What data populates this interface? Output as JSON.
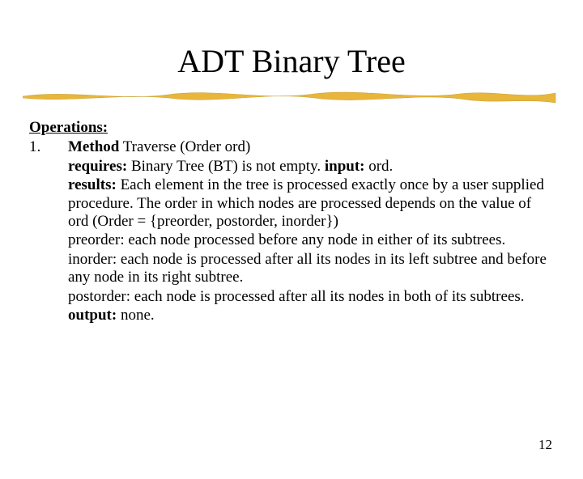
{
  "title": "ADT Binary Tree",
  "ops_heading": "Operations:",
  "item_number": "1.",
  "line_method_label": "Method",
  "line_method_rest": " Traverse (Order ord)",
  "line_requires_label": "requires:",
  "line_requires_rest": " Binary Tree (BT) is not empty.  ",
  "line_input_label": "input:",
  "line_input_rest": " ord.",
  "line_results_label": "results:",
  "line_results_rest": " Each element in the tree is processed exactly once by a user supplied procedure. The order in which nodes are processed depends on the value of ord (Order = {preorder, postorder, inorder})",
  "line_preorder": "preorder: each node processed before any node in either of its subtrees.",
  "line_inorder": "inorder: each node is processed after all its nodes in its left subtree and before any node in its right subtree.",
  "line_postorder": "postorder: each node is processed after all its nodes in both of its subtrees.",
  "line_output_label": " output:",
  "line_output_rest": " none.",
  "page_number": "12"
}
